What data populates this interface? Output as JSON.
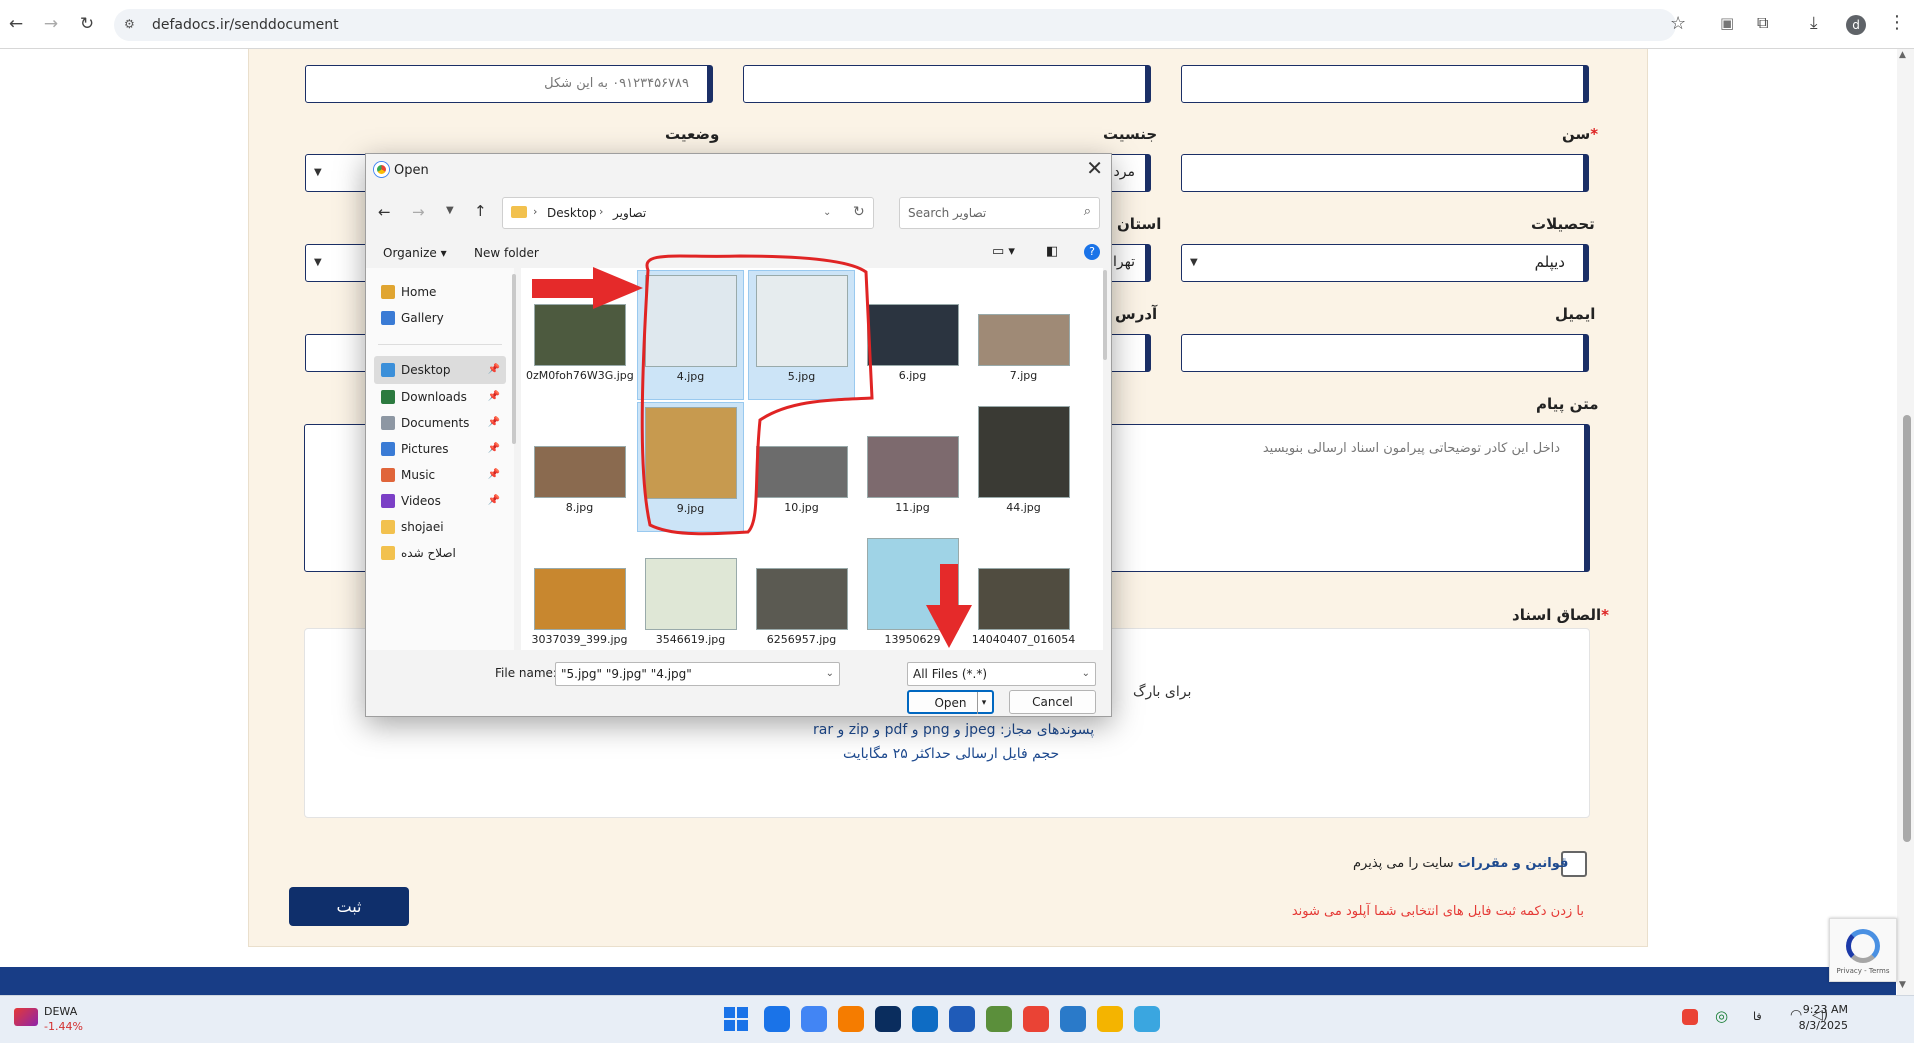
{
  "browser": {
    "url": "defadocs.ir/senddocument",
    "profile_initial": "d"
  },
  "form": {
    "phone_placeholder": "۰۹۱۲۳۴۵۶۷۸۹ به این شکل",
    "label_age": "سن",
    "required_mark": "*",
    "label_gender": "جنسیت",
    "gender_value": "مرد",
    "label_status": "وضعیت",
    "label_education": "تحصیلات",
    "education_value": "دیپلم",
    "label_province": "استان",
    "province_value": "تهرا",
    "label_email": "ایمیل",
    "label_address": "آدرس",
    "label_message": "متن پیام",
    "message_placeholder": "داخل این کادر توضیحاتی پیرامون اسناد ارسالی بنویسید",
    "label_attach": "الصاق اسناد",
    "upload_text": "برای بارگ",
    "allowed_ext": "پسوندهای مجاز: jpeg و png و pdf و zip و rar",
    "max_size": "حجم فایل ارسالی حداکثر ۲۵ مگابایت",
    "terms_link": "قوانین و مقررات",
    "terms_rest": "سایت را می پذیرم",
    "submit_label": "ثبت",
    "note": "با زدن دکمه ثبت فایل های انتخابی شما آپلود می شوند"
  },
  "dialog": {
    "title": "Open",
    "path_root": "Desktop",
    "path_folder": "تصاویر",
    "search_placeholder": "Search تصاویر",
    "organize": "Organize",
    "new_folder": "New folder",
    "sidebar": [
      {
        "label": "Home",
        "color": "#e0a531",
        "pinned": false
      },
      {
        "label": "Gallery",
        "color": "#3a7bd5",
        "pinned": false
      },
      {
        "label": "Desktop",
        "color": "#3b8fd9",
        "pinned": true
      },
      {
        "label": "Downloads",
        "color": "#2c7a3f",
        "pinned": true
      },
      {
        "label": "Documents",
        "color": "#8d97a3",
        "pinned": true
      },
      {
        "label": "Pictures",
        "color": "#3a7bd5",
        "pinned": true
      },
      {
        "label": "Music",
        "color": "#e0653a",
        "pinned": true
      },
      {
        "label": "Videos",
        "color": "#7b3fc6",
        "pinned": true
      },
      {
        "label": "shojaei",
        "color": "#f2c14e",
        "pinned": false
      },
      {
        "label": "اصلاح شده",
        "color": "#f2c14e",
        "pinned": false
      }
    ],
    "files": [
      {
        "name": "0zM0foh76W3G.jpg",
        "selected": false,
        "tone": "#4d5a3f"
      },
      {
        "name": "4.jpg",
        "selected": true,
        "tone": "#dfe8ee"
      },
      {
        "name": "5.jpg",
        "selected": true,
        "tone": "#e6ecee"
      },
      {
        "name": "6.jpg",
        "selected": false,
        "tone": "#2b3440"
      },
      {
        "name": "7.jpg",
        "selected": false,
        "tone": "#9f8a76"
      },
      {
        "name": "8.jpg",
        "selected": false,
        "tone": "#8a6a4f"
      },
      {
        "name": "9.jpg",
        "selected": true,
        "tone": "#c79a4f"
      },
      {
        "name": "10.jpg",
        "selected": false,
        "tone": "#6c6c6c"
      },
      {
        "name": "11.jpg",
        "selected": false,
        "tone": "#7d6a6e"
      },
      {
        "name": "44.jpg",
        "selected": false,
        "tone": "#3a3a34"
      },
      {
        "name": "3037039_399.jpg",
        "selected": false,
        "tone": "#c8872f"
      },
      {
        "name": "3546619.jpg",
        "selected": false,
        "tone": "#dfe7d6"
      },
      {
        "name": "6256957.jpg",
        "selected": false,
        "tone": "#5b5a52"
      },
      {
        "name": "13950629",
        "selected": false,
        "tone": "#9fd3e6"
      },
      {
        "name": "14040407_016054",
        "selected": false,
        "tone": "#504c40"
      }
    ],
    "filename_label": "File name:",
    "filename_value": "\"5.jpg\" \"9.jpg\" \"4.jpg\"",
    "filetype_value": "All Files (*.*)",
    "open_label": "Open",
    "cancel_label": "Cancel"
  },
  "taskbar": {
    "stock_name": "DEWA",
    "stock_change": "-1.44%",
    "time": "9:23 AM",
    "date": "8/3/2025",
    "lang": "فا",
    "icon_colors": [
      "#1a73e8",
      "#4285f4",
      "#f57c00",
      "#0a2d5e",
      "#0e6cc4",
      "#1f5bb8",
      "#5b8f3b",
      "#ea4335",
      "#2a7ac9",
      "#f4b400",
      "#3aa6e0"
    ]
  },
  "recaptcha": {
    "text": "Privacy - Terms"
  }
}
